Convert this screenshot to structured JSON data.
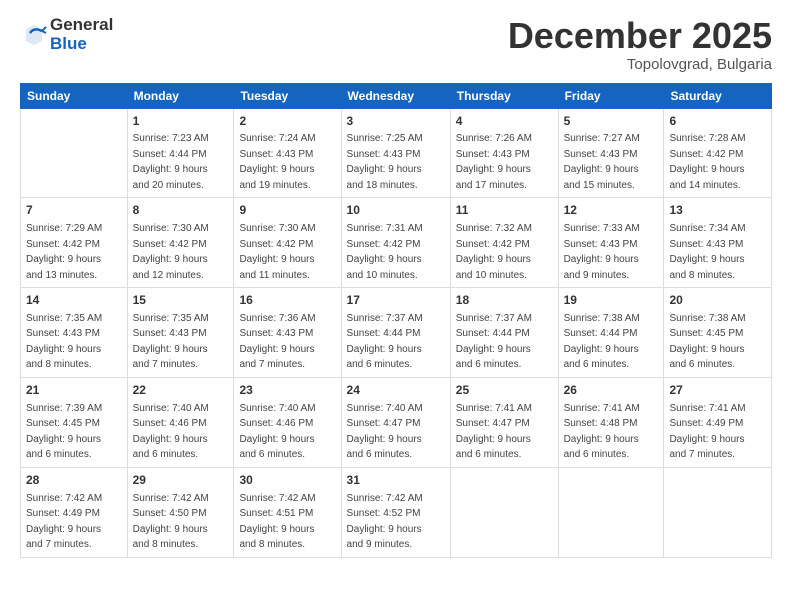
{
  "logo": {
    "general": "General",
    "blue": "Blue"
  },
  "header": {
    "month": "December 2025",
    "location": "Topolovgrad, Bulgaria"
  },
  "weekdays": [
    "Sunday",
    "Monday",
    "Tuesday",
    "Wednesday",
    "Thursday",
    "Friday",
    "Saturday"
  ],
  "weeks": [
    [
      {
        "day": "",
        "info": ""
      },
      {
        "day": "1",
        "info": "Sunrise: 7:23 AM\nSunset: 4:44 PM\nDaylight: 9 hours\nand 20 minutes."
      },
      {
        "day": "2",
        "info": "Sunrise: 7:24 AM\nSunset: 4:43 PM\nDaylight: 9 hours\nand 19 minutes."
      },
      {
        "day": "3",
        "info": "Sunrise: 7:25 AM\nSunset: 4:43 PM\nDaylight: 9 hours\nand 18 minutes."
      },
      {
        "day": "4",
        "info": "Sunrise: 7:26 AM\nSunset: 4:43 PM\nDaylight: 9 hours\nand 17 minutes."
      },
      {
        "day": "5",
        "info": "Sunrise: 7:27 AM\nSunset: 4:43 PM\nDaylight: 9 hours\nand 15 minutes."
      },
      {
        "day": "6",
        "info": "Sunrise: 7:28 AM\nSunset: 4:42 PM\nDaylight: 9 hours\nand 14 minutes."
      }
    ],
    [
      {
        "day": "7",
        "info": "Sunrise: 7:29 AM\nSunset: 4:42 PM\nDaylight: 9 hours\nand 13 minutes."
      },
      {
        "day": "8",
        "info": "Sunrise: 7:30 AM\nSunset: 4:42 PM\nDaylight: 9 hours\nand 12 minutes."
      },
      {
        "day": "9",
        "info": "Sunrise: 7:30 AM\nSunset: 4:42 PM\nDaylight: 9 hours\nand 11 minutes."
      },
      {
        "day": "10",
        "info": "Sunrise: 7:31 AM\nSunset: 4:42 PM\nDaylight: 9 hours\nand 10 minutes."
      },
      {
        "day": "11",
        "info": "Sunrise: 7:32 AM\nSunset: 4:42 PM\nDaylight: 9 hours\nand 10 minutes."
      },
      {
        "day": "12",
        "info": "Sunrise: 7:33 AM\nSunset: 4:43 PM\nDaylight: 9 hours\nand 9 minutes."
      },
      {
        "day": "13",
        "info": "Sunrise: 7:34 AM\nSunset: 4:43 PM\nDaylight: 9 hours\nand 8 minutes."
      }
    ],
    [
      {
        "day": "14",
        "info": "Sunrise: 7:35 AM\nSunset: 4:43 PM\nDaylight: 9 hours\nand 8 minutes."
      },
      {
        "day": "15",
        "info": "Sunrise: 7:35 AM\nSunset: 4:43 PM\nDaylight: 9 hours\nand 7 minutes."
      },
      {
        "day": "16",
        "info": "Sunrise: 7:36 AM\nSunset: 4:43 PM\nDaylight: 9 hours\nand 7 minutes."
      },
      {
        "day": "17",
        "info": "Sunrise: 7:37 AM\nSunset: 4:44 PM\nDaylight: 9 hours\nand 6 minutes."
      },
      {
        "day": "18",
        "info": "Sunrise: 7:37 AM\nSunset: 4:44 PM\nDaylight: 9 hours\nand 6 minutes."
      },
      {
        "day": "19",
        "info": "Sunrise: 7:38 AM\nSunset: 4:44 PM\nDaylight: 9 hours\nand 6 minutes."
      },
      {
        "day": "20",
        "info": "Sunrise: 7:38 AM\nSunset: 4:45 PM\nDaylight: 9 hours\nand 6 minutes."
      }
    ],
    [
      {
        "day": "21",
        "info": "Sunrise: 7:39 AM\nSunset: 4:45 PM\nDaylight: 9 hours\nand 6 minutes."
      },
      {
        "day": "22",
        "info": "Sunrise: 7:40 AM\nSunset: 4:46 PM\nDaylight: 9 hours\nand 6 minutes."
      },
      {
        "day": "23",
        "info": "Sunrise: 7:40 AM\nSunset: 4:46 PM\nDaylight: 9 hours\nand 6 minutes."
      },
      {
        "day": "24",
        "info": "Sunrise: 7:40 AM\nSunset: 4:47 PM\nDaylight: 9 hours\nand 6 minutes."
      },
      {
        "day": "25",
        "info": "Sunrise: 7:41 AM\nSunset: 4:47 PM\nDaylight: 9 hours\nand 6 minutes."
      },
      {
        "day": "26",
        "info": "Sunrise: 7:41 AM\nSunset: 4:48 PM\nDaylight: 9 hours\nand 6 minutes."
      },
      {
        "day": "27",
        "info": "Sunrise: 7:41 AM\nSunset: 4:49 PM\nDaylight: 9 hours\nand 7 minutes."
      }
    ],
    [
      {
        "day": "28",
        "info": "Sunrise: 7:42 AM\nSunset: 4:49 PM\nDaylight: 9 hours\nand 7 minutes."
      },
      {
        "day": "29",
        "info": "Sunrise: 7:42 AM\nSunset: 4:50 PM\nDaylight: 9 hours\nand 8 minutes."
      },
      {
        "day": "30",
        "info": "Sunrise: 7:42 AM\nSunset: 4:51 PM\nDaylight: 9 hours\nand 8 minutes."
      },
      {
        "day": "31",
        "info": "Sunrise: 7:42 AM\nSunset: 4:52 PM\nDaylight: 9 hours\nand 9 minutes."
      },
      {
        "day": "",
        "info": ""
      },
      {
        "day": "",
        "info": ""
      },
      {
        "day": "",
        "info": ""
      }
    ]
  ]
}
